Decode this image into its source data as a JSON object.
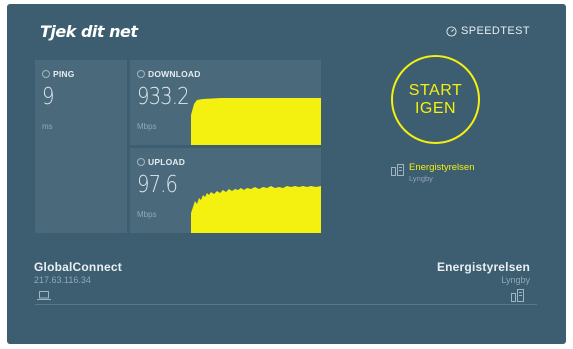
{
  "header": {
    "logo": "Tjek dit net",
    "speedtest_label": "SPEEDTEST"
  },
  "ping": {
    "label": "PING",
    "value": "9",
    "unit": "ms"
  },
  "download": {
    "label": "DOWNLOAD",
    "value": "933.2",
    "unit": "Mbps"
  },
  "upload": {
    "label": "UPLOAD",
    "value": "97.6",
    "unit": "Mbps"
  },
  "start_button": {
    "line1": "START",
    "line2": "IGEN"
  },
  "server": {
    "name": "Energistyrelsen",
    "city": "Lyngby"
  },
  "connection": {
    "isp_name": "GlobalConnect",
    "ip": "217.63.116.34",
    "server_name": "Energistyrelsen",
    "server_city": "Lyngby"
  },
  "colors": {
    "background": "#3d5d70",
    "panel": "#4a6a7c",
    "accent": "#f4f00f"
  }
}
